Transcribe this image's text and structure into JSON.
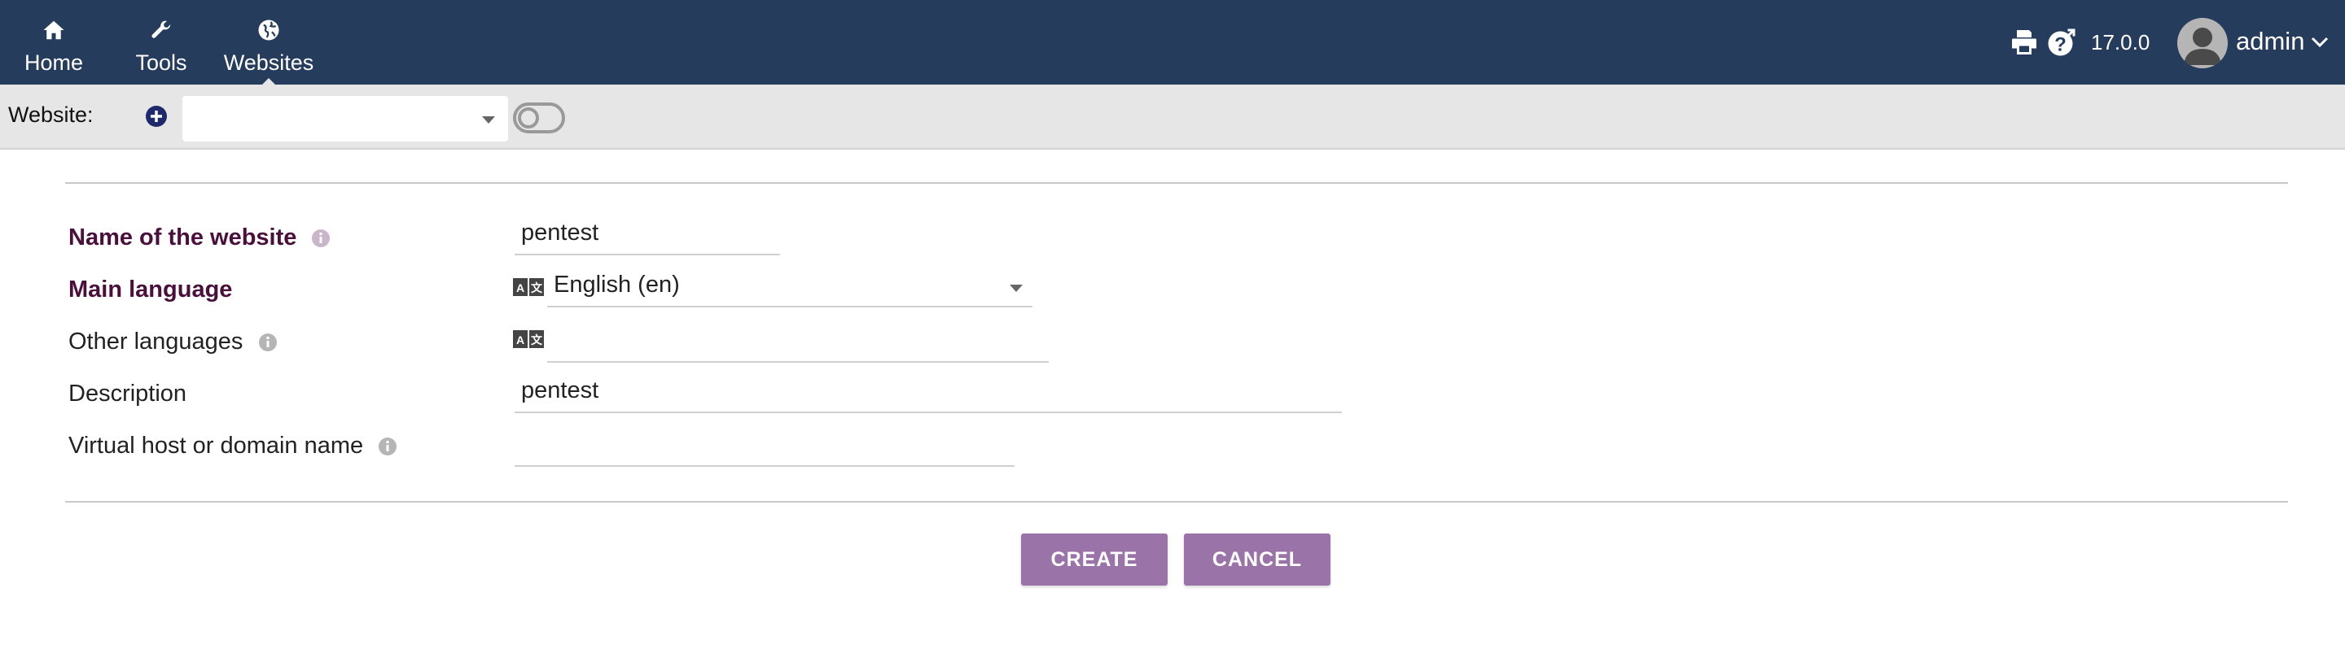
{
  "nav": {
    "items": [
      {
        "label": "Home",
        "icon": "home-icon"
      },
      {
        "label": "Tools",
        "icon": "wrench-icon"
      },
      {
        "label": "Websites",
        "icon": "globe-icon"
      }
    ],
    "active": "Websites"
  },
  "header": {
    "version": "17.0.0",
    "user_name": "admin"
  },
  "toolbar": {
    "website_label": "Website:",
    "website_select_value": ""
  },
  "form": {
    "name_label": "Name of the website",
    "name_value": "pentest",
    "main_language_label": "Main language",
    "main_language_value": "English (en)",
    "other_languages_label": "Other languages",
    "other_languages_value": "",
    "description_label": "Description",
    "description_value": "pentest",
    "virtual_host_label": "Virtual host or domain name",
    "virtual_host_value": ""
  },
  "buttons": {
    "create": "CREATE",
    "cancel": "CANCEL"
  },
  "colors": {
    "topbar": "#263c5c",
    "subbar": "#e6e6e6",
    "required_label": "#4a0f3a",
    "button": "#9a73a8"
  }
}
